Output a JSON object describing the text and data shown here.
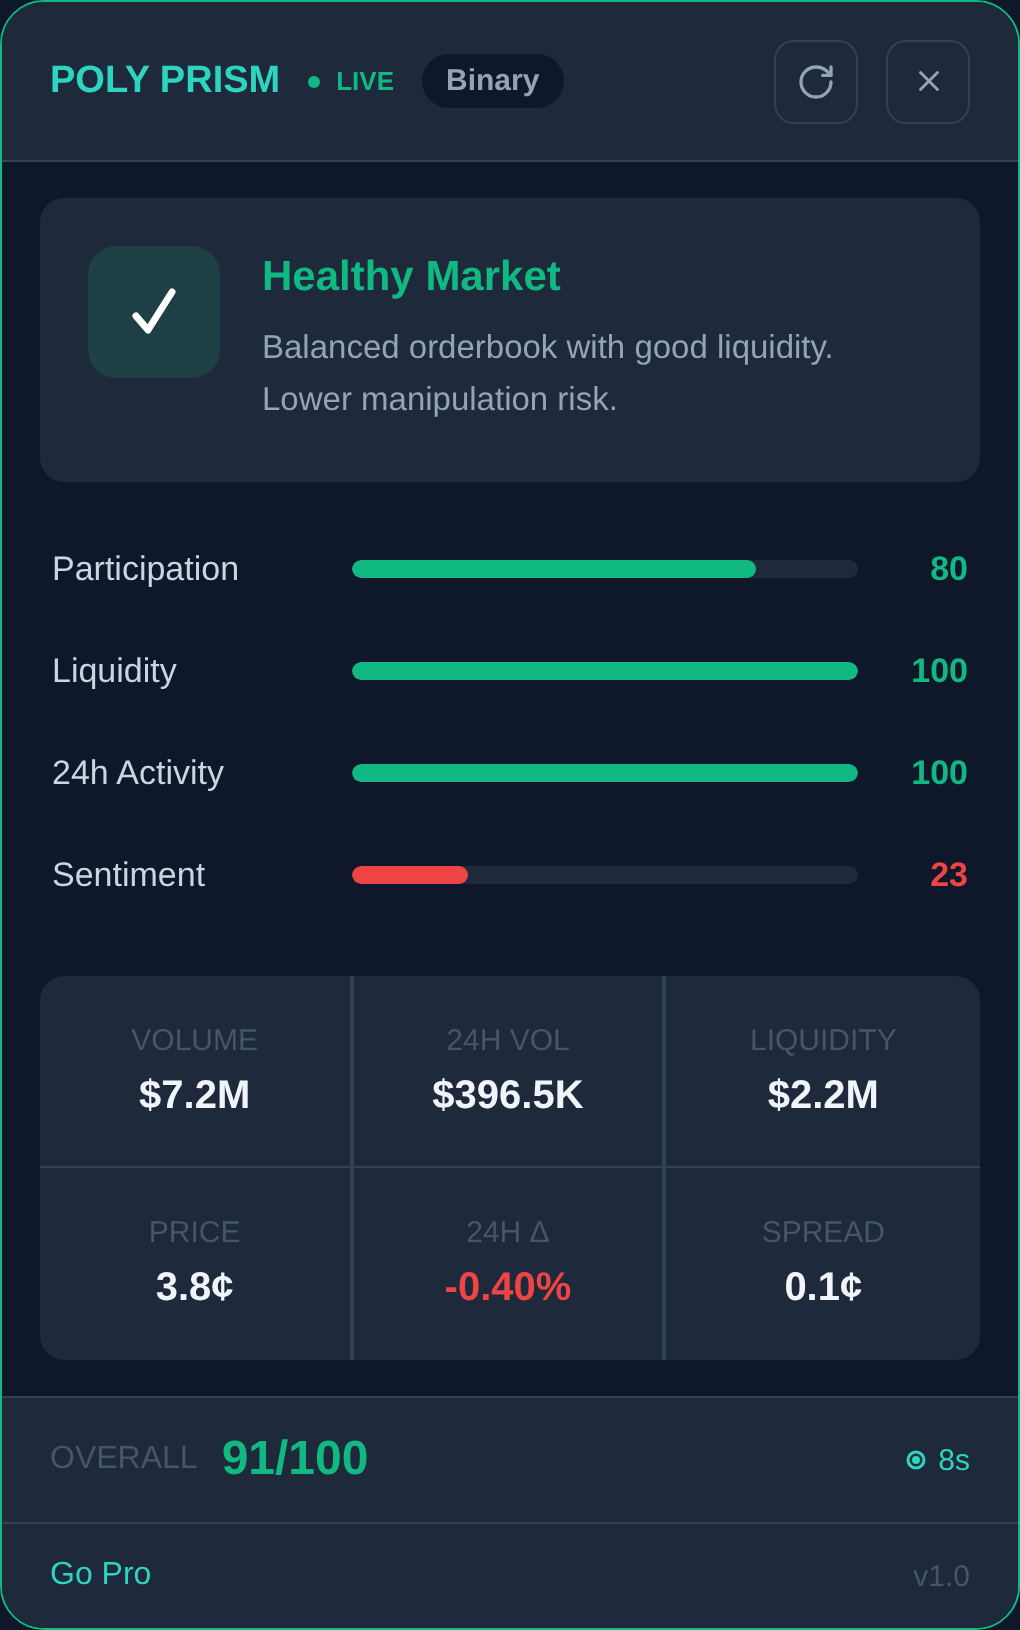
{
  "header": {
    "title": "POLY PRISM",
    "live": {
      "label": "LIVE",
      "on": true
    },
    "badge": "Binary"
  },
  "status": {
    "title": "Healthy Market",
    "description": "Balanced orderbook with good liquidity. Lower manipulation risk."
  },
  "meters": [
    {
      "name": "Participation",
      "level": 0.8,
      "reading": "80",
      "color": "#10b981"
    },
    {
      "name": "Liquidity",
      "level": 1.0,
      "reading": "100",
      "color": "#10b981"
    },
    {
      "name": "24h Activity",
      "level": 1.0,
      "reading": "100",
      "color": "#10b981"
    },
    {
      "name": "Sentiment",
      "level": 0.23,
      "reading": "23",
      "color": "#ef4444"
    }
  ],
  "stats": [
    {
      "label": "VOLUME",
      "value": "$7.2M",
      "color": "#f1f5f9"
    },
    {
      "label": "24H VOL",
      "value": "$396.5K",
      "color": "#f1f5f9"
    },
    {
      "label": "LIQUIDITY",
      "value": "$2.2M",
      "color": "#f1f5f9"
    },
    {
      "label": "PRICE",
      "value": "3.8¢",
      "color": "#f1f5f9"
    },
    {
      "label": "24H Δ",
      "value": "-0.40%",
      "color": "#ef4444"
    },
    {
      "label": "SPREAD",
      "value": "0.1¢",
      "color": "#f1f5f9"
    }
  ],
  "overall": {
    "label": "OVERALL",
    "score": "91/100",
    "timer": "8s"
  },
  "footer": {
    "link": "Go Pro",
    "version": "v1.0"
  }
}
